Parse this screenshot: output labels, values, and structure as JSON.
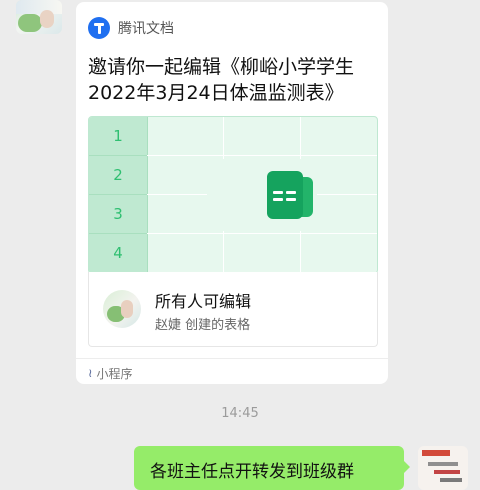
{
  "card": {
    "app_name": "腾讯文档",
    "title": "邀请你一起编辑《柳峪小学学生2022年3月24日体温监测表》",
    "row_numbers": [
      "1",
      "2",
      "3",
      "4"
    ],
    "permission": "所有人可编辑",
    "creator_line": "赵婕 创建的表格",
    "footer_label": "小程序",
    "accent_color": "#15a35e"
  },
  "timestamp": "14:45",
  "outgoing_message": {
    "text": "各班主任点开转发到班级群",
    "bubble_color": "#95ec69"
  },
  "icons": {
    "app_logo": "tencent-docs-logo-icon",
    "sheet": "spreadsheet-icon",
    "mini_program": "mini-program-icon"
  }
}
